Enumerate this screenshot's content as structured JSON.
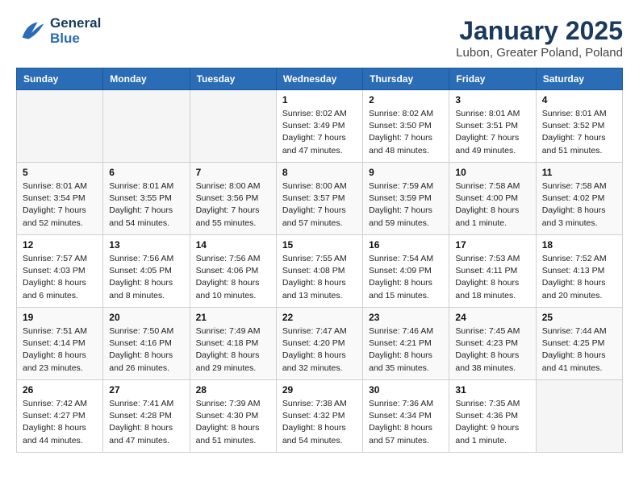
{
  "header": {
    "logo_general": "General",
    "logo_blue": "Blue",
    "month_title": "January 2025",
    "location": "Lubon, Greater Poland, Poland"
  },
  "calendar": {
    "days_of_week": [
      "Sunday",
      "Monday",
      "Tuesday",
      "Wednesday",
      "Thursday",
      "Friday",
      "Saturday"
    ],
    "weeks": [
      {
        "cells": [
          {
            "day": "",
            "info": ""
          },
          {
            "day": "",
            "info": ""
          },
          {
            "day": "",
            "info": ""
          },
          {
            "day": "1",
            "info": "Sunrise: 8:02 AM\nSunset: 3:49 PM\nDaylight: 7 hours and 47 minutes."
          },
          {
            "day": "2",
            "info": "Sunrise: 8:02 AM\nSunset: 3:50 PM\nDaylight: 7 hours and 48 minutes."
          },
          {
            "day": "3",
            "info": "Sunrise: 8:01 AM\nSunset: 3:51 PM\nDaylight: 7 hours and 49 minutes."
          },
          {
            "day": "4",
            "info": "Sunrise: 8:01 AM\nSunset: 3:52 PM\nDaylight: 7 hours and 51 minutes."
          }
        ]
      },
      {
        "cells": [
          {
            "day": "5",
            "info": "Sunrise: 8:01 AM\nSunset: 3:54 PM\nDaylight: 7 hours and 52 minutes."
          },
          {
            "day": "6",
            "info": "Sunrise: 8:01 AM\nSunset: 3:55 PM\nDaylight: 7 hours and 54 minutes."
          },
          {
            "day": "7",
            "info": "Sunrise: 8:00 AM\nSunset: 3:56 PM\nDaylight: 7 hours and 55 minutes."
          },
          {
            "day": "8",
            "info": "Sunrise: 8:00 AM\nSunset: 3:57 PM\nDaylight: 7 hours and 57 minutes."
          },
          {
            "day": "9",
            "info": "Sunrise: 7:59 AM\nSunset: 3:59 PM\nDaylight: 7 hours and 59 minutes."
          },
          {
            "day": "10",
            "info": "Sunrise: 7:58 AM\nSunset: 4:00 PM\nDaylight: 8 hours and 1 minute."
          },
          {
            "day": "11",
            "info": "Sunrise: 7:58 AM\nSunset: 4:02 PM\nDaylight: 8 hours and 3 minutes."
          }
        ]
      },
      {
        "cells": [
          {
            "day": "12",
            "info": "Sunrise: 7:57 AM\nSunset: 4:03 PM\nDaylight: 8 hours and 6 minutes."
          },
          {
            "day": "13",
            "info": "Sunrise: 7:56 AM\nSunset: 4:05 PM\nDaylight: 8 hours and 8 minutes."
          },
          {
            "day": "14",
            "info": "Sunrise: 7:56 AM\nSunset: 4:06 PM\nDaylight: 8 hours and 10 minutes."
          },
          {
            "day": "15",
            "info": "Sunrise: 7:55 AM\nSunset: 4:08 PM\nDaylight: 8 hours and 13 minutes."
          },
          {
            "day": "16",
            "info": "Sunrise: 7:54 AM\nSunset: 4:09 PM\nDaylight: 8 hours and 15 minutes."
          },
          {
            "day": "17",
            "info": "Sunrise: 7:53 AM\nSunset: 4:11 PM\nDaylight: 8 hours and 18 minutes."
          },
          {
            "day": "18",
            "info": "Sunrise: 7:52 AM\nSunset: 4:13 PM\nDaylight: 8 hours and 20 minutes."
          }
        ]
      },
      {
        "cells": [
          {
            "day": "19",
            "info": "Sunrise: 7:51 AM\nSunset: 4:14 PM\nDaylight: 8 hours and 23 minutes."
          },
          {
            "day": "20",
            "info": "Sunrise: 7:50 AM\nSunset: 4:16 PM\nDaylight: 8 hours and 26 minutes."
          },
          {
            "day": "21",
            "info": "Sunrise: 7:49 AM\nSunset: 4:18 PM\nDaylight: 8 hours and 29 minutes."
          },
          {
            "day": "22",
            "info": "Sunrise: 7:47 AM\nSunset: 4:20 PM\nDaylight: 8 hours and 32 minutes."
          },
          {
            "day": "23",
            "info": "Sunrise: 7:46 AM\nSunset: 4:21 PM\nDaylight: 8 hours and 35 minutes."
          },
          {
            "day": "24",
            "info": "Sunrise: 7:45 AM\nSunset: 4:23 PM\nDaylight: 8 hours and 38 minutes."
          },
          {
            "day": "25",
            "info": "Sunrise: 7:44 AM\nSunset: 4:25 PM\nDaylight: 8 hours and 41 minutes."
          }
        ]
      },
      {
        "cells": [
          {
            "day": "26",
            "info": "Sunrise: 7:42 AM\nSunset: 4:27 PM\nDaylight: 8 hours and 44 minutes."
          },
          {
            "day": "27",
            "info": "Sunrise: 7:41 AM\nSunset: 4:28 PM\nDaylight: 8 hours and 47 minutes."
          },
          {
            "day": "28",
            "info": "Sunrise: 7:39 AM\nSunset: 4:30 PM\nDaylight: 8 hours and 51 minutes."
          },
          {
            "day": "29",
            "info": "Sunrise: 7:38 AM\nSunset: 4:32 PM\nDaylight: 8 hours and 54 minutes."
          },
          {
            "day": "30",
            "info": "Sunrise: 7:36 AM\nSunset: 4:34 PM\nDaylight: 8 hours and 57 minutes."
          },
          {
            "day": "31",
            "info": "Sunrise: 7:35 AM\nSunset: 4:36 PM\nDaylight: 9 hours and 1 minute."
          },
          {
            "day": "",
            "info": ""
          }
        ]
      }
    ]
  }
}
